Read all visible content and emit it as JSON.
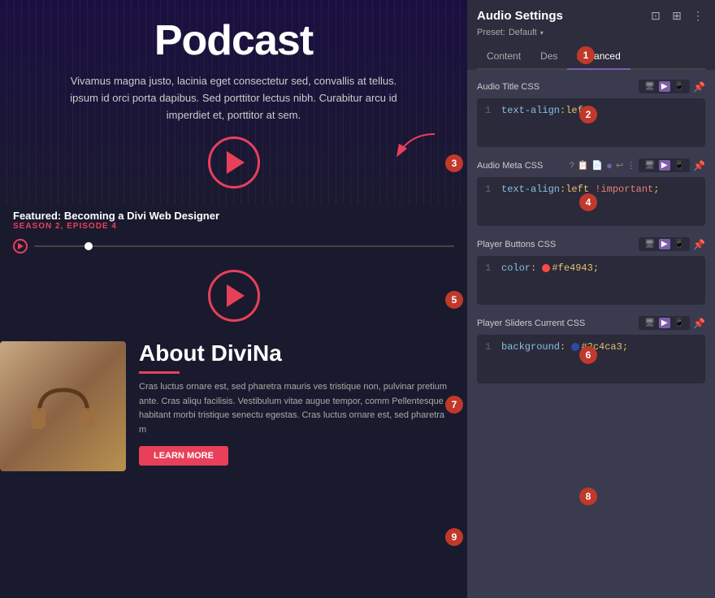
{
  "website": {
    "podcast_title": "Podcast",
    "podcast_desc": "Vivamus magna justo, lacinia eget consectetur sed, convallis at tellus. ipsum id orci porta dapibus. Sed porttitor lectus nibh. Curabitur arcu id imperdiet et, porttitor at sem.",
    "featured_label": "Featured: Becoming a Divi Web Designer",
    "season_label": "SEASON 2, EPISODE 4",
    "about_title": "About DiviNa",
    "about_desc": "Cras luctus ornare est, sed pharetra mauris ves tristique non, pulvinar pretium ante. Cras aliqu facilisis. Vestibulum vitae augue tempor, comm Pellentesque habitant morbi tristique senectu egestas. Cras luctus ornare est, sed pharetra m"
  },
  "settings": {
    "title": "Audio Settings",
    "preset_label": "Preset:",
    "preset_value": "Default",
    "tabs": [
      {
        "label": "Content",
        "active": false
      },
      {
        "label": "Des",
        "active": false
      },
      {
        "label": "Advanced",
        "active": true
      }
    ],
    "fields": [
      {
        "id": "audio-title-css",
        "label": "Audio Title CSS",
        "code": "text-align:left;"
      },
      {
        "id": "audio-meta-css",
        "label": "Audio Meta CSS",
        "code": "text-align:left !important;"
      },
      {
        "id": "player-buttons-css",
        "label": "Player Buttons CSS",
        "code": "color: #fe4943;"
      },
      {
        "id": "player-sliders-current-css",
        "label": "Player Sliders Current CSS",
        "code": "background: #2c4ca3;"
      }
    ],
    "colors": {
      "fe4943": "#fe4943",
      "2c4ca3": "#2c4ca3"
    }
  },
  "badges": [
    {
      "id": 1,
      "number": "1"
    },
    {
      "id": 2,
      "number": "2"
    },
    {
      "id": 3,
      "number": "3"
    },
    {
      "id": 4,
      "number": "4"
    },
    {
      "id": 5,
      "number": "5"
    },
    {
      "id": 6,
      "number": "6"
    },
    {
      "id": 7,
      "number": "7"
    },
    {
      "id": 8,
      "number": "8"
    },
    {
      "id": 9,
      "number": "9"
    }
  ]
}
